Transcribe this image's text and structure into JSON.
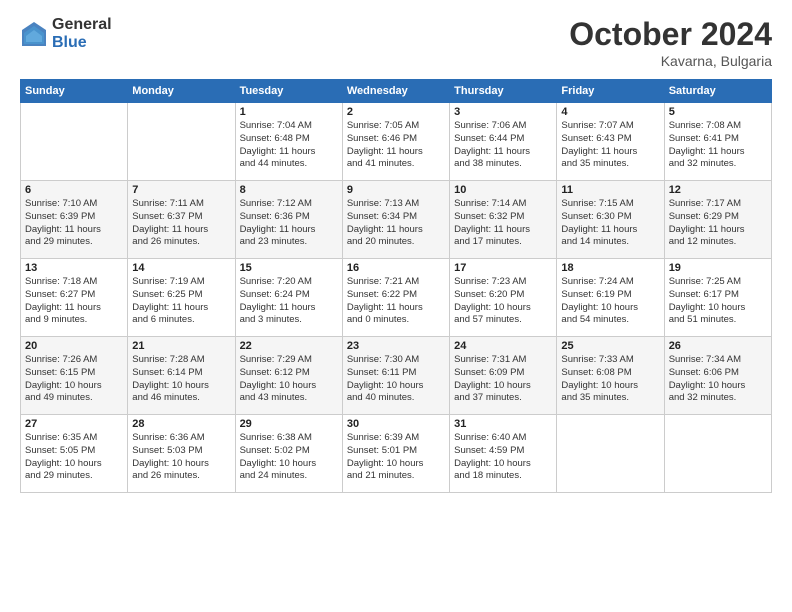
{
  "header": {
    "logo_general": "General",
    "logo_blue": "Blue",
    "month_title": "October 2024",
    "location": "Kavarna, Bulgaria"
  },
  "weekdays": [
    "Sunday",
    "Monday",
    "Tuesday",
    "Wednesday",
    "Thursday",
    "Friday",
    "Saturday"
  ],
  "weeks": [
    [
      {
        "day": "",
        "info": ""
      },
      {
        "day": "",
        "info": ""
      },
      {
        "day": "1",
        "info": "Sunrise: 7:04 AM\nSunset: 6:48 PM\nDaylight: 11 hours\nand 44 minutes."
      },
      {
        "day": "2",
        "info": "Sunrise: 7:05 AM\nSunset: 6:46 PM\nDaylight: 11 hours\nand 41 minutes."
      },
      {
        "day": "3",
        "info": "Sunrise: 7:06 AM\nSunset: 6:44 PM\nDaylight: 11 hours\nand 38 minutes."
      },
      {
        "day": "4",
        "info": "Sunrise: 7:07 AM\nSunset: 6:43 PM\nDaylight: 11 hours\nand 35 minutes."
      },
      {
        "day": "5",
        "info": "Sunrise: 7:08 AM\nSunset: 6:41 PM\nDaylight: 11 hours\nand 32 minutes."
      }
    ],
    [
      {
        "day": "6",
        "info": "Sunrise: 7:10 AM\nSunset: 6:39 PM\nDaylight: 11 hours\nand 29 minutes."
      },
      {
        "day": "7",
        "info": "Sunrise: 7:11 AM\nSunset: 6:37 PM\nDaylight: 11 hours\nand 26 minutes."
      },
      {
        "day": "8",
        "info": "Sunrise: 7:12 AM\nSunset: 6:36 PM\nDaylight: 11 hours\nand 23 minutes."
      },
      {
        "day": "9",
        "info": "Sunrise: 7:13 AM\nSunset: 6:34 PM\nDaylight: 11 hours\nand 20 minutes."
      },
      {
        "day": "10",
        "info": "Sunrise: 7:14 AM\nSunset: 6:32 PM\nDaylight: 11 hours\nand 17 minutes."
      },
      {
        "day": "11",
        "info": "Sunrise: 7:15 AM\nSunset: 6:30 PM\nDaylight: 11 hours\nand 14 minutes."
      },
      {
        "day": "12",
        "info": "Sunrise: 7:17 AM\nSunset: 6:29 PM\nDaylight: 11 hours\nand 12 minutes."
      }
    ],
    [
      {
        "day": "13",
        "info": "Sunrise: 7:18 AM\nSunset: 6:27 PM\nDaylight: 11 hours\nand 9 minutes."
      },
      {
        "day": "14",
        "info": "Sunrise: 7:19 AM\nSunset: 6:25 PM\nDaylight: 11 hours\nand 6 minutes."
      },
      {
        "day": "15",
        "info": "Sunrise: 7:20 AM\nSunset: 6:24 PM\nDaylight: 11 hours\nand 3 minutes."
      },
      {
        "day": "16",
        "info": "Sunrise: 7:21 AM\nSunset: 6:22 PM\nDaylight: 11 hours\nand 0 minutes."
      },
      {
        "day": "17",
        "info": "Sunrise: 7:23 AM\nSunset: 6:20 PM\nDaylight: 10 hours\nand 57 minutes."
      },
      {
        "day": "18",
        "info": "Sunrise: 7:24 AM\nSunset: 6:19 PM\nDaylight: 10 hours\nand 54 minutes."
      },
      {
        "day": "19",
        "info": "Sunrise: 7:25 AM\nSunset: 6:17 PM\nDaylight: 10 hours\nand 51 minutes."
      }
    ],
    [
      {
        "day": "20",
        "info": "Sunrise: 7:26 AM\nSunset: 6:15 PM\nDaylight: 10 hours\nand 49 minutes."
      },
      {
        "day": "21",
        "info": "Sunrise: 7:28 AM\nSunset: 6:14 PM\nDaylight: 10 hours\nand 46 minutes."
      },
      {
        "day": "22",
        "info": "Sunrise: 7:29 AM\nSunset: 6:12 PM\nDaylight: 10 hours\nand 43 minutes."
      },
      {
        "day": "23",
        "info": "Sunrise: 7:30 AM\nSunset: 6:11 PM\nDaylight: 10 hours\nand 40 minutes."
      },
      {
        "day": "24",
        "info": "Sunrise: 7:31 AM\nSunset: 6:09 PM\nDaylight: 10 hours\nand 37 minutes."
      },
      {
        "day": "25",
        "info": "Sunrise: 7:33 AM\nSunset: 6:08 PM\nDaylight: 10 hours\nand 35 minutes."
      },
      {
        "day": "26",
        "info": "Sunrise: 7:34 AM\nSunset: 6:06 PM\nDaylight: 10 hours\nand 32 minutes."
      }
    ],
    [
      {
        "day": "27",
        "info": "Sunrise: 6:35 AM\nSunset: 5:05 PM\nDaylight: 10 hours\nand 29 minutes."
      },
      {
        "day": "28",
        "info": "Sunrise: 6:36 AM\nSunset: 5:03 PM\nDaylight: 10 hours\nand 26 minutes."
      },
      {
        "day": "29",
        "info": "Sunrise: 6:38 AM\nSunset: 5:02 PM\nDaylight: 10 hours\nand 24 minutes."
      },
      {
        "day": "30",
        "info": "Sunrise: 6:39 AM\nSunset: 5:01 PM\nDaylight: 10 hours\nand 21 minutes."
      },
      {
        "day": "31",
        "info": "Sunrise: 6:40 AM\nSunset: 4:59 PM\nDaylight: 10 hours\nand 18 minutes."
      },
      {
        "day": "",
        "info": ""
      },
      {
        "day": "",
        "info": ""
      }
    ]
  ]
}
